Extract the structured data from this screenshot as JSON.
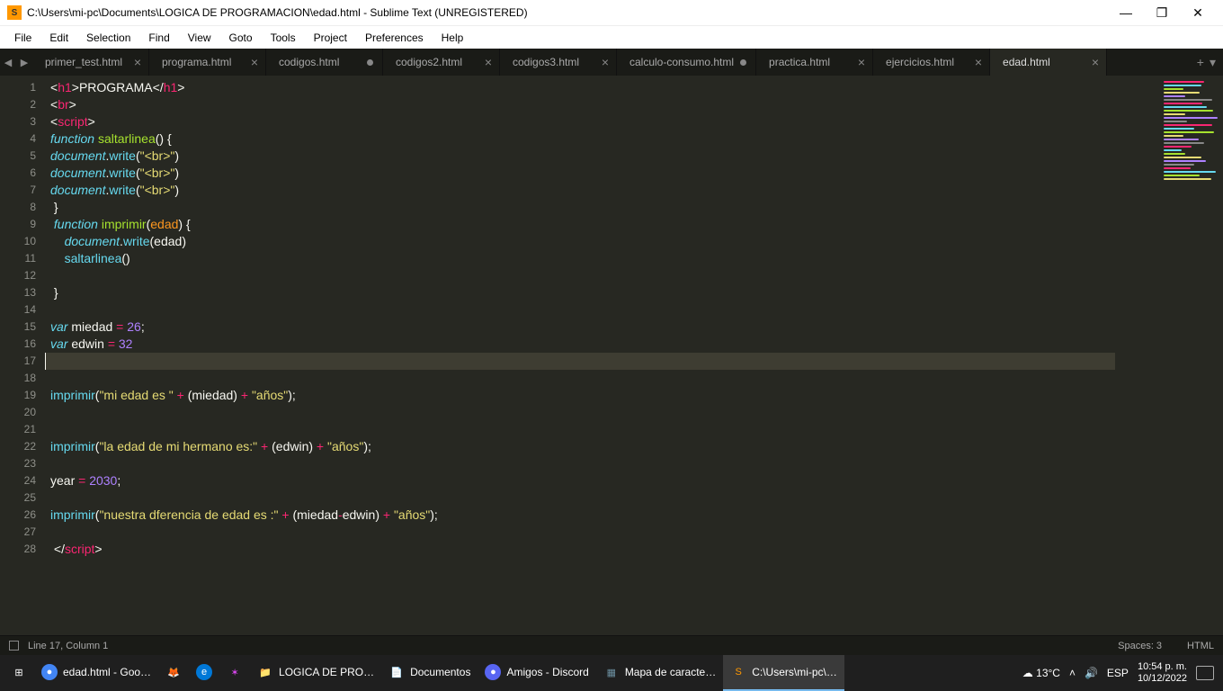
{
  "window": {
    "title": "C:\\Users\\mi-pc\\Documents\\LOGICA DE PROGRAMACION\\edad.html - Sublime Text (UNREGISTERED)",
    "app_icon": "S"
  },
  "menu": [
    "File",
    "Edit",
    "Selection",
    "Find",
    "View",
    "Goto",
    "Tools",
    "Project",
    "Preferences",
    "Help"
  ],
  "tabs": [
    {
      "label": "primer_test.html",
      "dirty": false,
      "active": false
    },
    {
      "label": "programa.html",
      "dirty": false,
      "active": false
    },
    {
      "label": "codigos.html",
      "dirty": true,
      "active": false
    },
    {
      "label": "codigos2.html",
      "dirty": false,
      "active": false
    },
    {
      "label": "codigos3.html",
      "dirty": false,
      "active": false
    },
    {
      "label": "calculo-consumo.html",
      "dirty": true,
      "active": false
    },
    {
      "label": "practica.html",
      "dirty": false,
      "active": false
    },
    {
      "label": "ejercicios.html",
      "dirty": false,
      "active": false
    },
    {
      "label": "edad.html",
      "dirty": false,
      "active": true
    }
  ],
  "lines": [
    [
      {
        "t": "<",
        "c": "w"
      },
      {
        "t": "h1",
        "c": "red"
      },
      {
        "t": ">",
        "c": "w"
      },
      {
        "t": "PROGRAMA",
        "c": "w"
      },
      {
        "t": "</",
        "c": "w"
      },
      {
        "t": "h1",
        "c": "red"
      },
      {
        "t": ">",
        "c": "w"
      }
    ],
    [
      {
        "t": "<",
        "c": "w"
      },
      {
        "t": "br",
        "c": "red"
      },
      {
        "t": ">",
        "c": "w"
      }
    ],
    [
      {
        "t": "<",
        "c": "w"
      },
      {
        "t": "script",
        "c": "red"
      },
      {
        "t": ">",
        "c": "w"
      }
    ],
    [
      {
        "t": "function",
        "c": "blue"
      },
      {
        "t": " ",
        "c": "w"
      },
      {
        "t": "saltarlinea",
        "c": "grn"
      },
      {
        "t": "() {",
        "c": "w"
      }
    ],
    [
      {
        "t": "document",
        "c": "blue"
      },
      {
        "t": ".",
        "c": "w"
      },
      {
        "t": "write",
        "c": "blue2"
      },
      {
        "t": "(",
        "c": "w"
      },
      {
        "t": "\"<br>\"",
        "c": "gold"
      },
      {
        "t": ")",
        "c": "w"
      }
    ],
    [
      {
        "t": "document",
        "c": "blue"
      },
      {
        "t": ".",
        "c": "w"
      },
      {
        "t": "write",
        "c": "blue2"
      },
      {
        "t": "(",
        "c": "w"
      },
      {
        "t": "\"<br>\"",
        "c": "gold"
      },
      {
        "t": ")",
        "c": "w"
      }
    ],
    [
      {
        "t": "document",
        "c": "blue"
      },
      {
        "t": ".",
        "c": "w"
      },
      {
        "t": "write",
        "c": "blue2"
      },
      {
        "t": "(",
        "c": "w"
      },
      {
        "t": "\"<br>\"",
        "c": "gold"
      },
      {
        "t": ")",
        "c": "w"
      }
    ],
    [
      {
        "t": " }",
        "c": "w"
      }
    ],
    [
      {
        "t": " ",
        "c": "w"
      },
      {
        "t": "function",
        "c": "blue"
      },
      {
        "t": " ",
        "c": "w"
      },
      {
        "t": "imprimir",
        "c": "grn"
      },
      {
        "t": "(",
        "c": "w"
      },
      {
        "t": "edad",
        "c": "or"
      },
      {
        "t": ") {",
        "c": "w"
      }
    ],
    [
      {
        "t": "    ",
        "c": "w"
      },
      {
        "t": "document",
        "c": "blue"
      },
      {
        "t": ".",
        "c": "w"
      },
      {
        "t": "write",
        "c": "blue2"
      },
      {
        "t": "(",
        "c": "w"
      },
      {
        "t": "edad",
        "c": "w"
      },
      {
        "t": ")",
        "c": "w"
      }
    ],
    [
      {
        "t": "    ",
        "c": "w"
      },
      {
        "t": "saltarlinea",
        "c": "blue2"
      },
      {
        "t": "()",
        "c": "w"
      }
    ],
    [
      {
        "t": "",
        "c": "w"
      }
    ],
    [
      {
        "t": " }",
        "c": "w"
      }
    ],
    [
      {
        "t": "",
        "c": "w"
      }
    ],
    [
      {
        "t": "var",
        "c": "blue"
      },
      {
        "t": " miedad ",
        "c": "w"
      },
      {
        "t": "=",
        "c": "red"
      },
      {
        "t": " ",
        "c": "w"
      },
      {
        "t": "26",
        "c": "pur"
      },
      {
        "t": ";",
        "c": "w"
      }
    ],
    [
      {
        "t": "var",
        "c": "blue"
      },
      {
        "t": " edwin ",
        "c": "w"
      },
      {
        "t": "=",
        "c": "red"
      },
      {
        "t": " ",
        "c": "w"
      },
      {
        "t": "32",
        "c": "pur"
      }
    ],
    [
      {
        "t": "",
        "c": "w"
      }
    ],
    [
      {
        "t": "",
        "c": "w"
      }
    ],
    [
      {
        "t": "imprimir",
        "c": "blue2"
      },
      {
        "t": "(",
        "c": "w"
      },
      {
        "t": "\"mi edad es \"",
        "c": "gold"
      },
      {
        "t": " ",
        "c": "w"
      },
      {
        "t": "+",
        "c": "red"
      },
      {
        "t": " (miedad) ",
        "c": "w"
      },
      {
        "t": "+",
        "c": "red"
      },
      {
        "t": " ",
        "c": "w"
      },
      {
        "t": "\"años\"",
        "c": "gold"
      },
      {
        "t": ");",
        "c": "w"
      }
    ],
    [
      {
        "t": "",
        "c": "w"
      }
    ],
    [
      {
        "t": "",
        "c": "w"
      }
    ],
    [
      {
        "t": "imprimir",
        "c": "blue2"
      },
      {
        "t": "(",
        "c": "w"
      },
      {
        "t": "\"la edad de mi hermano es:\"",
        "c": "gold"
      },
      {
        "t": " ",
        "c": "w"
      },
      {
        "t": "+",
        "c": "red"
      },
      {
        "t": " (edwin) ",
        "c": "w"
      },
      {
        "t": "+",
        "c": "red"
      },
      {
        "t": " ",
        "c": "w"
      },
      {
        "t": "\"años\"",
        "c": "gold"
      },
      {
        "t": ");",
        "c": "w"
      }
    ],
    [
      {
        "t": "",
        "c": "w"
      }
    ],
    [
      {
        "t": "year ",
        "c": "w"
      },
      {
        "t": "=",
        "c": "red"
      },
      {
        "t": " ",
        "c": "w"
      },
      {
        "t": "2030",
        "c": "pur"
      },
      {
        "t": ";",
        "c": "w"
      }
    ],
    [
      {
        "t": "",
        "c": "w"
      }
    ],
    [
      {
        "t": "imprimir",
        "c": "blue2"
      },
      {
        "t": "(",
        "c": "w"
      },
      {
        "t": "\"nuestra dferencia de edad es :\"",
        "c": "gold"
      },
      {
        "t": " ",
        "c": "w"
      },
      {
        "t": "+",
        "c": "red"
      },
      {
        "t": " (miedad",
        "c": "w"
      },
      {
        "t": "-",
        "c": "red"
      },
      {
        "t": "edwin) ",
        "c": "w"
      },
      {
        "t": "+",
        "c": "red"
      },
      {
        "t": " ",
        "c": "w"
      },
      {
        "t": "\"años\"",
        "c": "gold"
      },
      {
        "t": ");",
        "c": "w"
      }
    ],
    [
      {
        "t": "",
        "c": "w"
      }
    ],
    [
      {
        "t": " </",
        "c": "w"
      },
      {
        "t": "script",
        "c": "red"
      },
      {
        "t": ">",
        "c": "w"
      }
    ]
  ],
  "cursor_line": 17,
  "status": {
    "pos": "Line 17, Column 1",
    "spaces": "Spaces: 3",
    "lang": "HTML"
  },
  "taskbar": {
    "items": [
      {
        "label": "",
        "icon": "⊞",
        "color": "#fff"
      },
      {
        "label": "edad.html - Goo…",
        "icon": "●",
        "color": "#4285f4",
        "circle": true
      },
      {
        "label": "",
        "icon": "🦊",
        "color": "#ff7139"
      },
      {
        "label": "",
        "icon": "e",
        "color": "#0078d7",
        "circle": true
      },
      {
        "label": "",
        "icon": "✶",
        "color": "#d946ef"
      },
      {
        "label": "LOGICA DE PRO…",
        "icon": "📁",
        "color": "#ffb900"
      },
      {
        "label": "Documentos",
        "icon": "📄",
        "color": "#2b579a"
      },
      {
        "label": "Amigos - Discord",
        "icon": "●",
        "color": "#5865f2",
        "circle": true
      },
      {
        "label": "Mapa de caracte…",
        "icon": "▦",
        "color": "#6b8e9f"
      },
      {
        "label": "C:\\Users\\mi-pc\\…",
        "icon": "S",
        "color": "#ff9800",
        "active": true
      }
    ],
    "weather": "13°C",
    "lang": "ESP",
    "time": "10:54 p. m.",
    "date": "10/12/2022"
  }
}
